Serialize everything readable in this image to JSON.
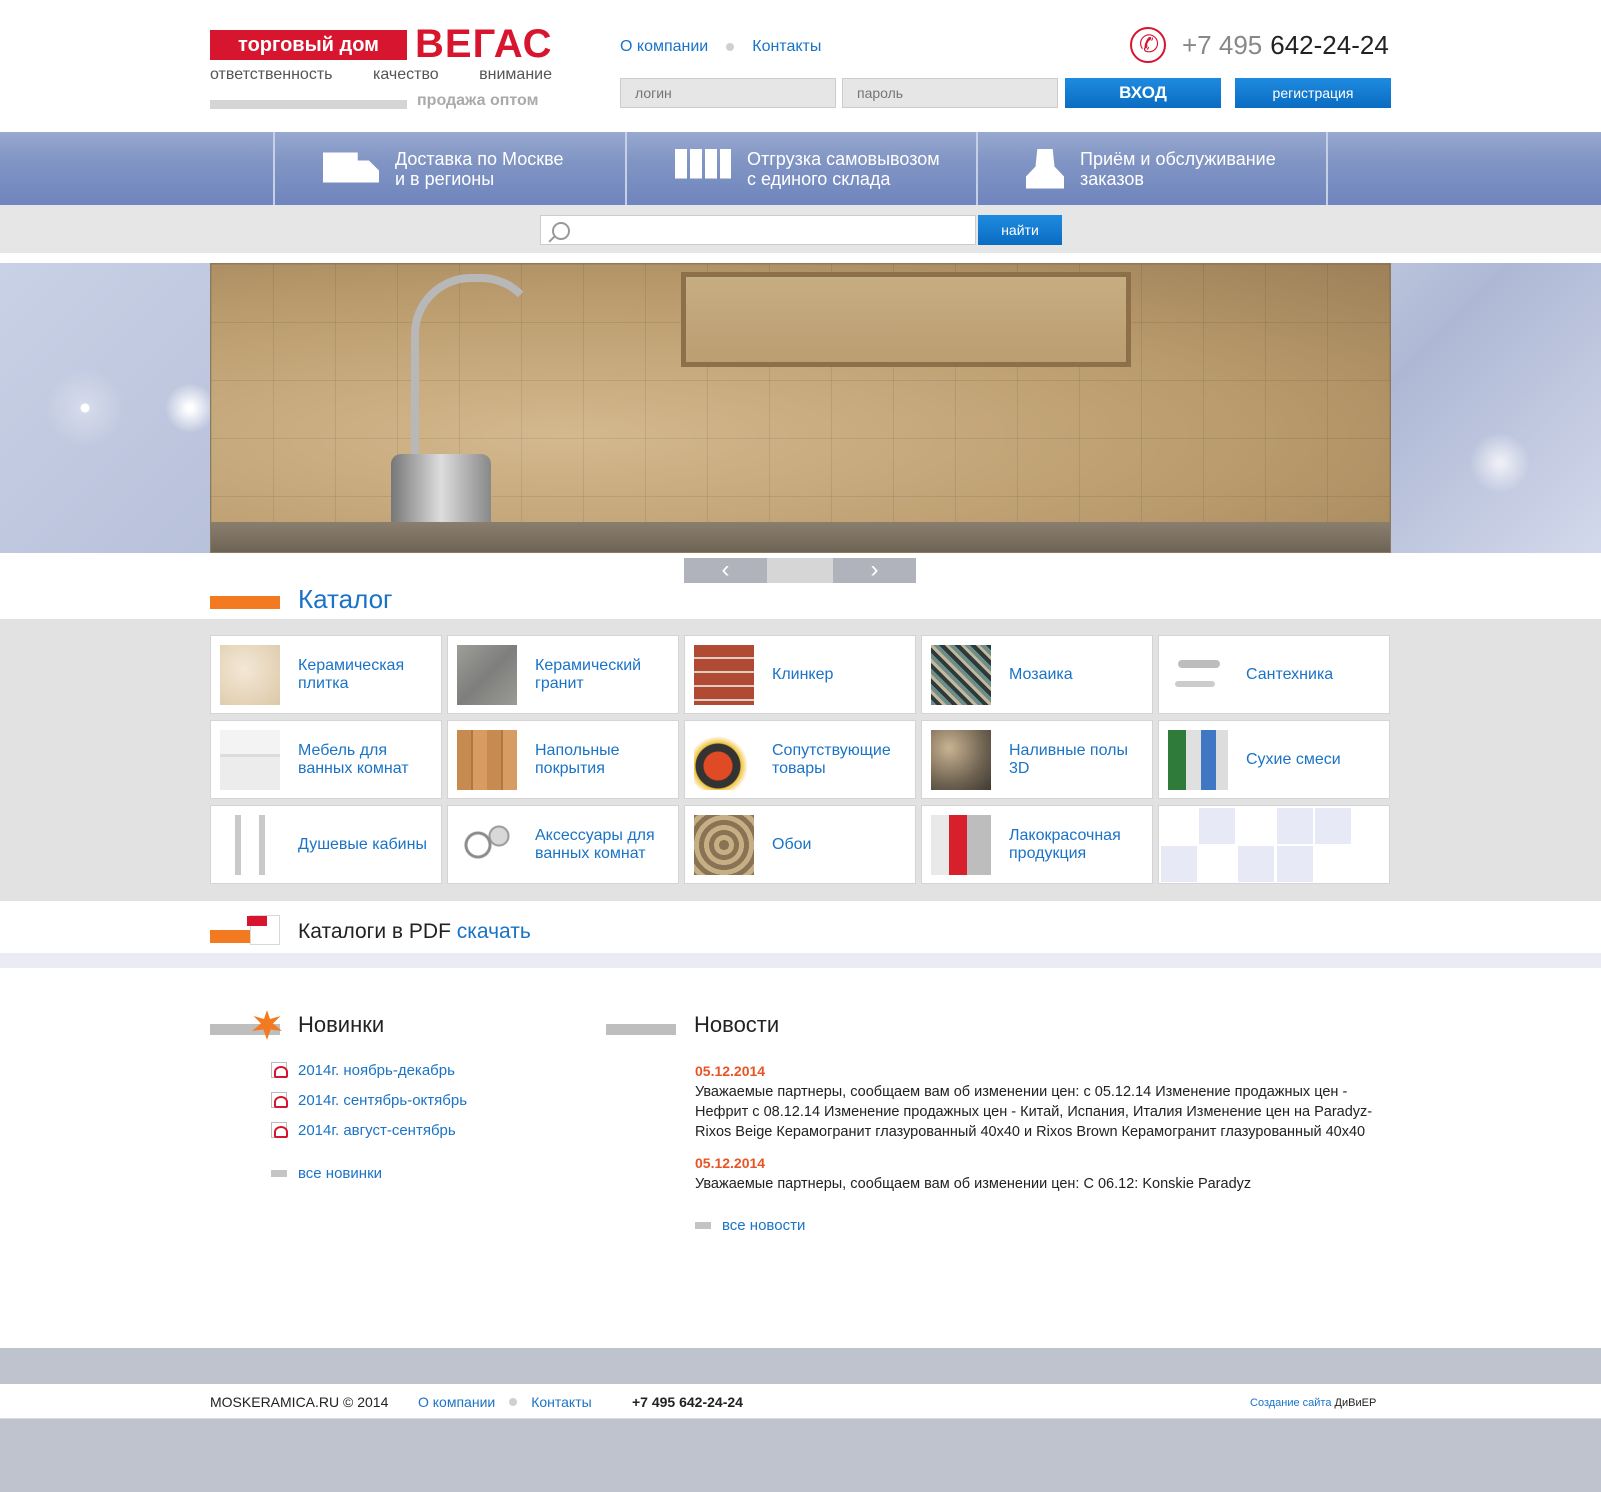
{
  "logo": {
    "top": "торговый дом",
    "brand": "ВЕГАС",
    "tagline": [
      "ответственность",
      "качество",
      "внимание"
    ],
    "sub": "продажа оптом"
  },
  "topnav": {
    "about": "О компании",
    "contacts": "Контакты"
  },
  "phone": {
    "prefix": "+7 495",
    "number": "642-24-24"
  },
  "auth": {
    "login_placeholder": "логин",
    "password_placeholder": "пароль",
    "enter": "ВХОД",
    "register": "регистрация"
  },
  "services": [
    {
      "line1": "Доставка по Москве",
      "line2": "и в регионы",
      "icon": "truck-icon"
    },
    {
      "line1": "Отгрузка самовывозом",
      "line2": "с единого склада",
      "icon": "pallet-icon"
    },
    {
      "line1": "Приём и обслуживание",
      "line2": "заказов",
      "icon": "operator-icon"
    }
  ],
  "search": {
    "button": "найти"
  },
  "slider": {
    "prev": "‹",
    "next": "›"
  },
  "catalog": {
    "title": "Каталог",
    "items": [
      "Керамическая плитка",
      "Керамический гранит",
      "Клинкер",
      "Мозаика",
      "Сантехника",
      "Мебель для ванных комнат",
      "Напольные покрытия",
      "Сопутствующие товары",
      "Наливные полы 3D",
      "Сухие смеси",
      "Душевые кабины",
      "Аксессуары для ванных комнат",
      "Обои",
      "Лакокрасочная продукция"
    ]
  },
  "pdf": {
    "text": "Каталоги в PDF",
    "link": "скачать"
  },
  "novelties": {
    "title": "Новинки",
    "items": [
      "2014г.  ноябрь-декабрь",
      "2014г. сентябрь-октябрь",
      "2014г. август-сентябрь"
    ],
    "all": "все новинки"
  },
  "news": {
    "title": "Новости",
    "items": [
      {
        "date": "05.12.2014",
        "text": "Уважаемые партнеры, сообщаем вам об изменении цен: с 05.12.14 Изменение продажных цен - Нефрит с 08.12.14 Изменение продажных цен - Китай, Испания, Италия Изменение цен на Paradyz- Rixos Beige Керамогранит глазурованный 40х40 и Rixos Brown Керамогранит глазурованный 40х40"
      },
      {
        "date": "05.12.2014",
        "text": "Уважаемые партнеры, сообщаем вам об изменении цен: С 06.12: Konskie Paradyz"
      }
    ],
    "all": "все новости"
  },
  "footer": {
    "copyright": "MOSKERAMICA.RU © 2014",
    "about": "О компании",
    "contacts": "Контакты",
    "phone": "+7 495 642-24-24",
    "dev_label": "Создание сайта",
    "dev_name": "ДиВиЕР"
  },
  "colors": {
    "brand_red": "#d8152f",
    "link_blue": "#1a73c6",
    "accent_orange": "#f47a22",
    "button_blue": "#0a6cc2"
  }
}
